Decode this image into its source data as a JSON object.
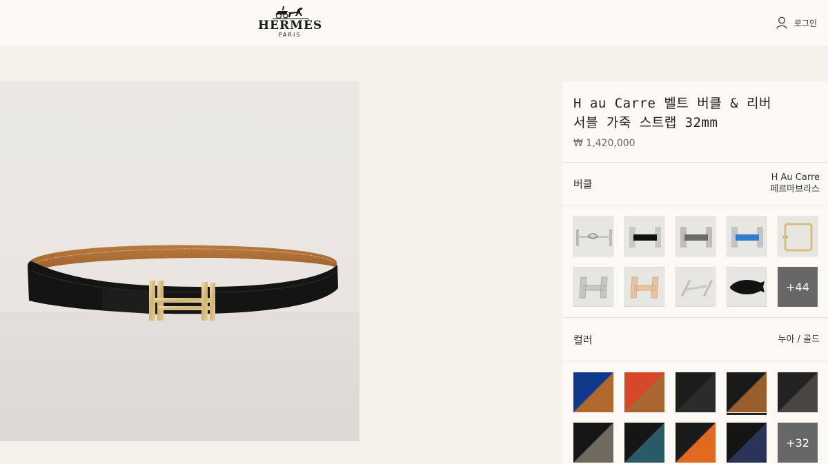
{
  "header": {
    "brand": "HERMÈS",
    "city": "PARIS",
    "login_label": "로그인",
    "login_icon": "user-icon"
  },
  "product": {
    "title_line1": "H au Carre 벨트 버클 & 리버",
    "title_line2": "서블 가죽 스트랩 32mm",
    "price": "₩ 1,420,000",
    "image_icon": "belt-image"
  },
  "buckle": {
    "label": "버클",
    "selected_name": "H Au Carre",
    "selected_finish": "페르마브라스",
    "thumbnails": [
      "buckle-hook-silver",
      "buckle-h-black",
      "buckle-h-grey",
      "buckle-h-blue",
      "buckle-rectangle-gold",
      "buckle-h-silver-3d",
      "buckle-h-rose-gold",
      "buckle-clip-silver",
      "buckle-animal-black"
    ],
    "more_label": "+44"
  },
  "color": {
    "label": "컬러",
    "selected_value": "누아 / 골드",
    "swatches": [
      {
        "name": "blue-gold",
        "top": "#0f3a8c",
        "bottom": "#b06a2e"
      },
      {
        "name": "multicolor-gold",
        "top": "#d7482a",
        "bottom": "#a86631"
      },
      {
        "name": "black-crocodile",
        "top": "#1c1c1c",
        "bottom": "#2b2b2b"
      },
      {
        "name": "noir-gold",
        "top": "#1a1a1a",
        "bottom": "#9a5d2e"
      },
      {
        "name": "black-grey",
        "top": "#222222",
        "bottom": "#4a4541"
      },
      {
        "name": "black-taupe",
        "top": "#161616",
        "bottom": "#6f685f"
      },
      {
        "name": "black-teal",
        "top": "#151515",
        "bottom": "#2a5a66"
      },
      {
        "name": "black-orange",
        "top": "#1a1a1a",
        "bottom": "#e06a22"
      },
      {
        "name": "black-navy",
        "top": "#151515",
        "bottom": "#2a3359"
      }
    ],
    "more_label": "+32"
  }
}
